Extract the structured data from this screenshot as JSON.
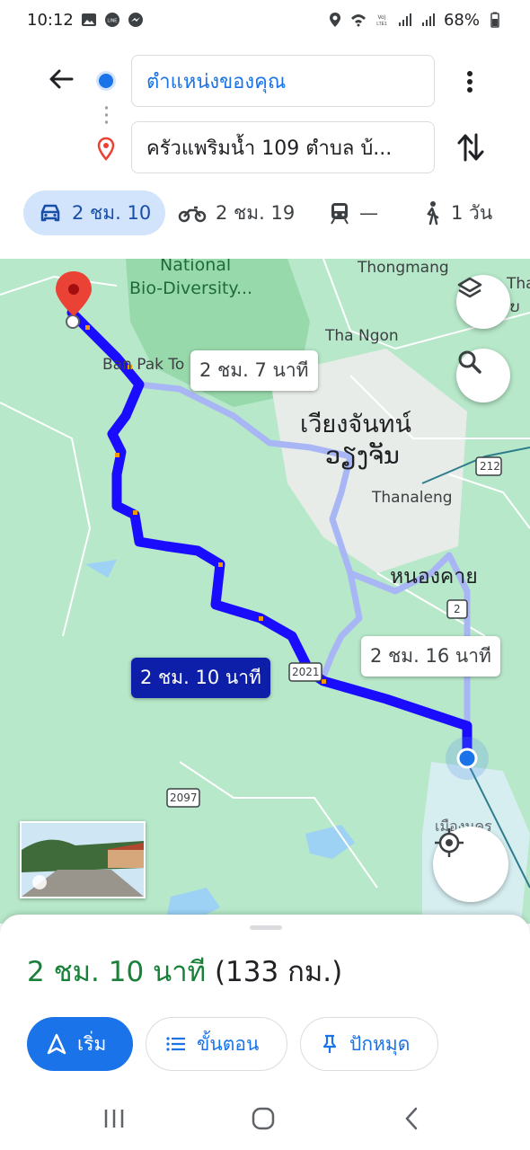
{
  "status": {
    "time": "10:12",
    "battery": "68%"
  },
  "route": {
    "from": "ตำแหน่งของคุณ",
    "to": "ครัวแพริมน้ำ 109 ตำบล บ้..."
  },
  "modes": [
    {
      "icon": "car-icon",
      "label": "2 ชม. 10"
    },
    {
      "icon": "motorcycle-icon",
      "label": "2 ชม. 19"
    },
    {
      "icon": "train-icon",
      "label": "—"
    },
    {
      "icon": "walk-icon",
      "label": "1 วัน"
    }
  ],
  "map": {
    "labels": {
      "national": "National",
      "biodiversity": "Bio-Diversity...",
      "thongmang": "Thongmang",
      "tha_edge": "Tha",
      "lao_edge": "ບ",
      "thangon": "Tha Ngon",
      "banpak": "Ban Pak To",
      "vientiane_th": "เวียงจันทน์",
      "vientiane_lo": "ວຽງຈັນ",
      "thanaleng": "Thanaleng",
      "nongkhai": "หนองคาย",
      "road212": "212",
      "road2": "2",
      "road2021": "2021",
      "road2097": "2097",
      "bottom_edge": "เมืองนคร"
    },
    "route_bubbles": {
      "alt1": "2 ชม. 7 นาที",
      "selected": "2 ชม. 10 นาที",
      "alt2": "2 ชม. 16 นาที"
    },
    "colors": {
      "route": "#1a0dff",
      "alt_route": "#a9b6f5",
      "map_bg": "#b7e8c9",
      "pin": "#ea4335"
    }
  },
  "summary": {
    "time": "2 ชม. 10 นาที",
    "distance": "(133 กม.)"
  },
  "actions": {
    "start": "เริ่ม",
    "steps": "ขั้นตอน",
    "pin": "ปักหมุด"
  }
}
